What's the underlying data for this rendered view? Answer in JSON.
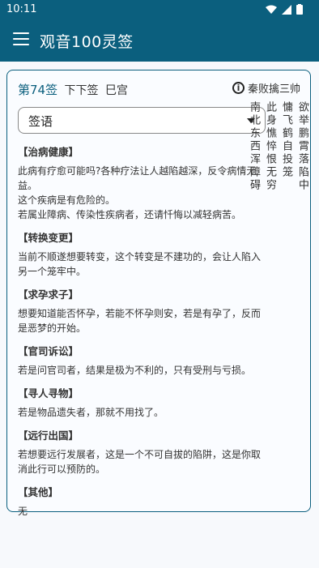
{
  "status_bar": {
    "time": "10:11"
  },
  "app_bar": {
    "title": "观音100灵签"
  },
  "lot": {
    "number": "第74签",
    "grade": "下下签",
    "palace": "巳宫",
    "story": "秦败擒三帅",
    "poem_lines": [
      "南北东西浑障碍",
      "此身憔悴恨无穷",
      "慵飞鹤自投笼",
      "欲举鹏霄落陷中"
    ]
  },
  "select": {
    "value": "签语"
  },
  "sections": [
    {
      "title": "【治病健康】",
      "body": "此病有疗愈可能吗?各种疗法让人越陷越深，反令病情无益。\n这个疾病是有危险的。\n若属业障病、传染性疾病者，还请忏悔以减轻病苦。"
    },
    {
      "title": "【转换变更】",
      "body": "当前不顺遂想要转变，这个转变是不建功的，会让人陷入另一个笼牢中。"
    },
    {
      "title": "【求孕求子】",
      "body": "想要知道能否怀孕，若能不怀孕则安，若是有孕了，反而是恶梦的开始。"
    },
    {
      "title": "【官司诉讼】",
      "body": "若是问官司者，结果是极为不利的，只有受刑与亏损。"
    },
    {
      "title": "【寻人寻物】",
      "body": "若是物品遗失者，那就不用找了。"
    },
    {
      "title": "【远行出国】",
      "body": "若想要远行发展者，这是一个不可自拔的陷阱，这是你取消此行可以预防的。"
    },
    {
      "title": "【其他】",
      "body": "无"
    }
  ]
}
